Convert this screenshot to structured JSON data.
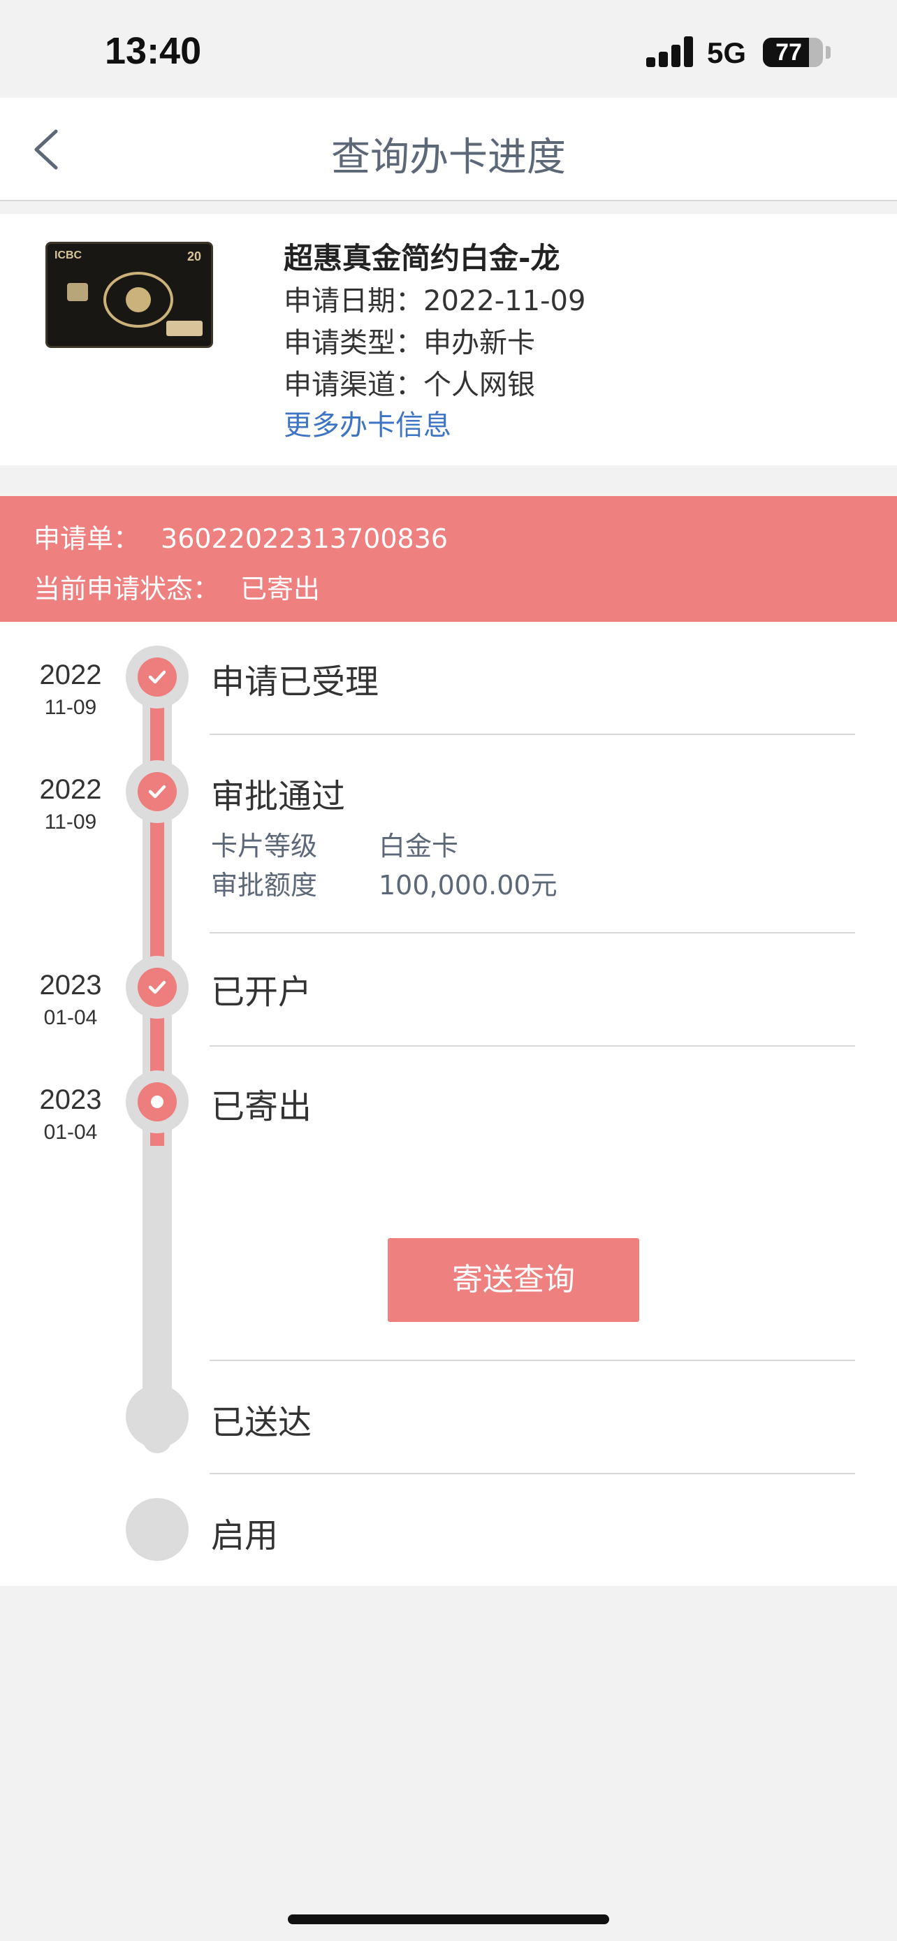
{
  "status_bar": {
    "time": "13:40",
    "network": "5G",
    "battery": "77",
    "battery_level": 0.77
  },
  "header": {
    "title": "查询办卡进度"
  },
  "card": {
    "name": "超惠真金简约白金-龙",
    "apply_date": "申请日期：2022-11-09",
    "apply_type": "申请类型：申办新卡",
    "apply_channel": "申请渠道：个人网银",
    "more_link": "更多办卡信息",
    "image": {
      "brand": "ICBC",
      "number": "20"
    }
  },
  "application": {
    "number_label": "申请单：",
    "number": "36022022313700836",
    "status_label": "当前申请状态：",
    "status": "已寄出"
  },
  "timeline": {
    "steps": [
      {
        "year": "2022",
        "date": "11-09",
        "title": "申请已受理",
        "state": "done"
      },
      {
        "year": "2022",
        "date": "11-09",
        "title": "审批通过",
        "state": "done",
        "details": [
          {
            "label": "卡片等级",
            "value": "白金卡"
          },
          {
            "label": "审批额度",
            "value": "100,000.00元"
          }
        ]
      },
      {
        "year": "2023",
        "date": "01-04",
        "title": "已开户",
        "state": "done"
      },
      {
        "year": "2023",
        "date": "01-04",
        "title": "已寄出",
        "state": "current"
      },
      {
        "year": "",
        "date": "",
        "title": "已送达",
        "state": "pending"
      },
      {
        "year": "",
        "date": "",
        "title": "启用",
        "state": "pending"
      }
    ],
    "track_button": "寄送查询"
  },
  "colors": {
    "accent": "#ee8080",
    "link": "#3e74c4",
    "track_gray": "#dcdcdc"
  }
}
